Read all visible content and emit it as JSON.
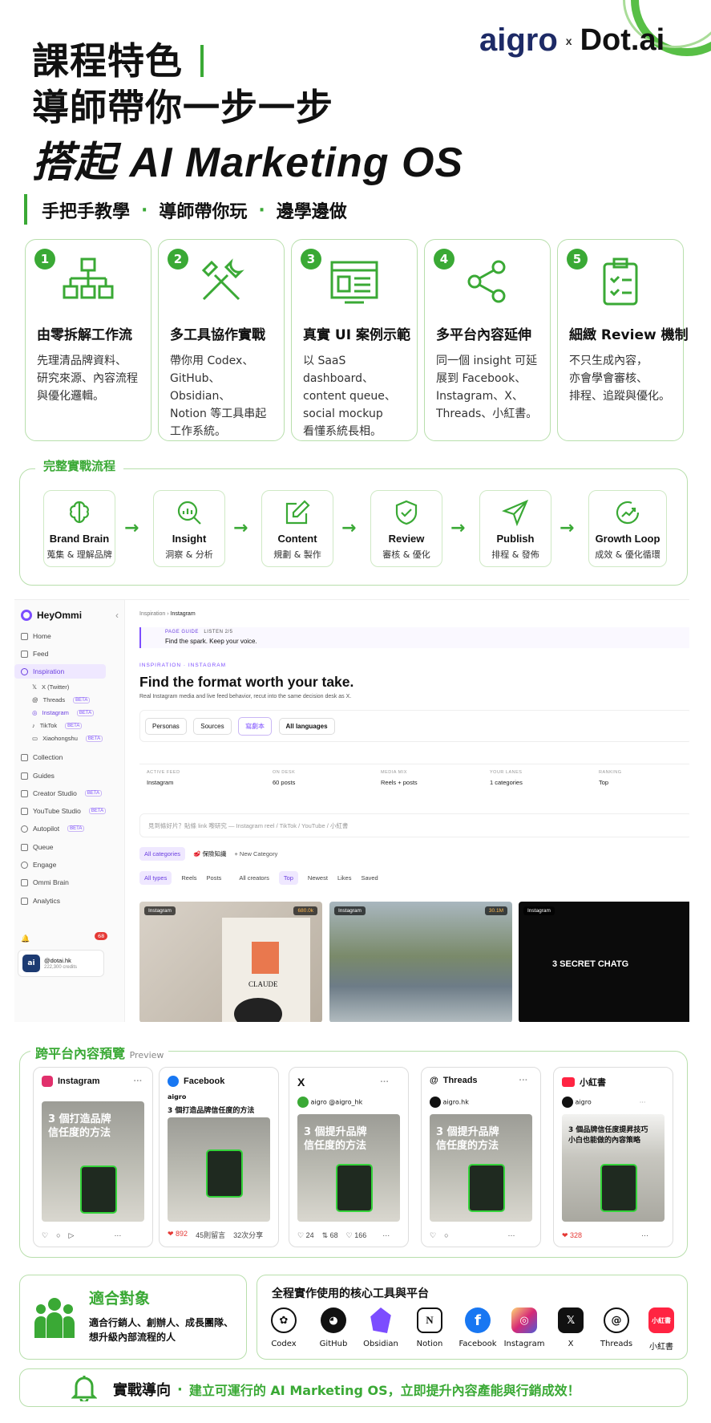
{
  "header": {
    "title_line1": "課程特色",
    "title_line2": "導師帶你一步一步",
    "title_line3": "搭起 AI Marketing OS",
    "tagline_parts": [
      "手把手教學",
      "導師帶你玩",
      "邊學邊做"
    ],
    "brand_left": "aigro",
    "brand_x": "x",
    "brand_right": "Dot.ai"
  },
  "features": [
    {
      "num": "1",
      "icon": "org-chart-icon",
      "title": "由零拆解工作流",
      "desc": "先理清品牌資料、\n研究來源、內容流程\n與優化邏輯。"
    },
    {
      "num": "2",
      "icon": "tools-icon",
      "title": "多工具協作實戰",
      "desc": "帶你用 Codex、\nGitHub、Obsidian、\nNotion 等工具串起\n工作系統。"
    },
    {
      "num": "3",
      "icon": "dashboard-icon",
      "title": "真實 UI 案例示範",
      "desc": "以 SaaS dashboard、\ncontent queue、\nsocial mockup\n看懂系統長相。"
    },
    {
      "num": "4",
      "icon": "share-icon",
      "title": "多平台內容延伸",
      "desc": "同一個 insight 可延\n展到 Facebook、\nInstagram、X、\nThreads、小紅書。"
    },
    {
      "num": "5",
      "icon": "clipboard-check-icon",
      "title": "細緻 Review 機制",
      "desc": "不只生成內容，\n亦會學會審核、\n排程、追蹤與優化。"
    }
  ],
  "flow": {
    "label": "完整實戰流程",
    "steps": [
      {
        "en": "Brand Brain",
        "zh": "蒐集 & 理解品牌"
      },
      {
        "en": "Insight",
        "zh": "洞察 & 分析"
      },
      {
        "en": "Content",
        "zh": "規劃 & 製作"
      },
      {
        "en": "Review",
        "zh": "審核 & 優化"
      },
      {
        "en": "Publish",
        "zh": "排程 & 發佈"
      },
      {
        "en": "Growth Loop",
        "zh": "成效 & 優化循環"
      }
    ]
  },
  "app": {
    "name": "HeyOmmi",
    "sidebar": [
      {
        "label": "Home"
      },
      {
        "label": "Feed"
      },
      {
        "label": "Inspiration"
      },
      {
        "label": "X (Twitter)"
      },
      {
        "label": "Threads",
        "badge": "BETA"
      },
      {
        "label": "Instagram",
        "badge": "BETA"
      },
      {
        "label": "TikTok",
        "badge": "BETA"
      },
      {
        "label": "Xiaohongshu",
        "badge": "BETA"
      },
      {
        "label": "Collection"
      },
      {
        "label": "Guides"
      },
      {
        "label": "Creator Studio",
        "badge": "BETA"
      },
      {
        "label": "YouTube Studio",
        "badge": "BETA"
      },
      {
        "label": "Autopilot",
        "badge": "BETA"
      },
      {
        "label": "Queue"
      },
      {
        "label": "Engage"
      },
      {
        "label": "Ommi Brain"
      },
      {
        "label": "Analytics"
      }
    ],
    "notif_count": "68",
    "account": {
      "handle": "@dotai.hk",
      "credits": "222,300 credits"
    },
    "breadcrumb": [
      "Inspiration",
      "Instagram"
    ],
    "guide": {
      "tag": "PAGE GUIDE",
      "listen": "LISTEN 2/5",
      "text": "Find the spark. Keep your voice."
    },
    "kicker": "INSPIRATION · INSTAGRAM",
    "heading": "Find the format worth your take.",
    "subheading": "Real Instagram media and live feed behavior, recut into the same decision desk as X.",
    "filters": [
      "Personas",
      "Sources",
      "寫劇本",
      "All languages"
    ],
    "stats": [
      {
        "k": "ACTIVE FEED",
        "v": "Instagram"
      },
      {
        "k": "ON DESK",
        "v": "60 posts"
      },
      {
        "k": "MEDIA MIX",
        "v": "Reels + posts"
      },
      {
        "k": "YOUR LANES",
        "v": "1 categories"
      },
      {
        "k": "RANKING",
        "v": "Top"
      }
    ],
    "search_placeholder": "見到條好片？貼條 link 嚟研究 — Instagram reel / TikTok / YouTube / 小紅書",
    "categories": [
      "All categories",
      "🥩 保險知識",
      "+ New Category"
    ],
    "types": [
      "All types",
      "Reels",
      "Posts",
      "All creators",
      "Top",
      "Newest",
      "Likes",
      "Saved"
    ],
    "tiles": [
      {
        "label": "Instagram",
        "count": "680.0k",
        "caption": "CLAUDE"
      },
      {
        "label": "Instagram",
        "count": "30.1M",
        "caption": ""
      },
      {
        "label": "Instagram",
        "count": "",
        "caption": "3 SECRET CHATG"
      }
    ]
  },
  "preview": {
    "label": "跨平台內容預覽",
    "label_en": "Preview",
    "cards": [
      {
        "platform": "Instagram",
        "user": "",
        "caption": "",
        "img_text": "3 個打造品牌\n信任度的方法",
        "foot": [
          "♡",
          "○",
          "▷",
          "···"
        ]
      },
      {
        "platform": "Facebook",
        "user": "aigro",
        "caption": "3 個打造品牌信任度的方法",
        "img_text": "",
        "foot": [
          "❤ 892",
          "45則留言",
          "32次分享"
        ]
      },
      {
        "platform": "X",
        "user": "aigro @aigro_hk",
        "caption": "",
        "img_text": "3 個提升品牌\n信任度的方法",
        "foot": [
          "♡ 24",
          "⇅ 68",
          "♡ 166",
          "···"
        ]
      },
      {
        "platform": "Threads",
        "user": "aigro.hk",
        "caption": "",
        "img_text": "3 個提升品牌\n信任度的方法",
        "foot": [
          "♡",
          "○",
          "···"
        ]
      },
      {
        "platform": "小紅書",
        "user": "aigro",
        "caption": "",
        "img_text": "3 個品牌信任度提昇技巧\n小白也能做的內容策略",
        "foot": [
          "❤ 328",
          "···"
        ]
      }
    ]
  },
  "audience": {
    "title": "適合對象",
    "desc": "適合行銷人、創辦人、成長團隊、\n想升級內部流程的人"
  },
  "tools": {
    "title": "全程實作使用的核心工具與平台",
    "items": [
      {
        "name": "Codex",
        "color": "#ffffff"
      },
      {
        "name": "GitHub",
        "color": "#111111"
      },
      {
        "name": "Obsidian",
        "color": "#7c4dff"
      },
      {
        "name": "Notion",
        "color": "#ffffff"
      },
      {
        "name": "Facebook",
        "color": "#1877f2"
      },
      {
        "name": "Instagram",
        "color": "#e1306c"
      },
      {
        "name": "X",
        "color": "#111111"
      },
      {
        "name": "Threads",
        "color": "#ffffff"
      },
      {
        "name": "小紅書",
        "color": "#ff2442"
      }
    ]
  },
  "banner": {
    "lead": "實戰導向",
    "text": "建立可運行的 AI Marketing OS，立即提升內容產能與行銷成效！"
  },
  "colors": {
    "accent": "#3aa935",
    "border": "#b8dfac"
  }
}
